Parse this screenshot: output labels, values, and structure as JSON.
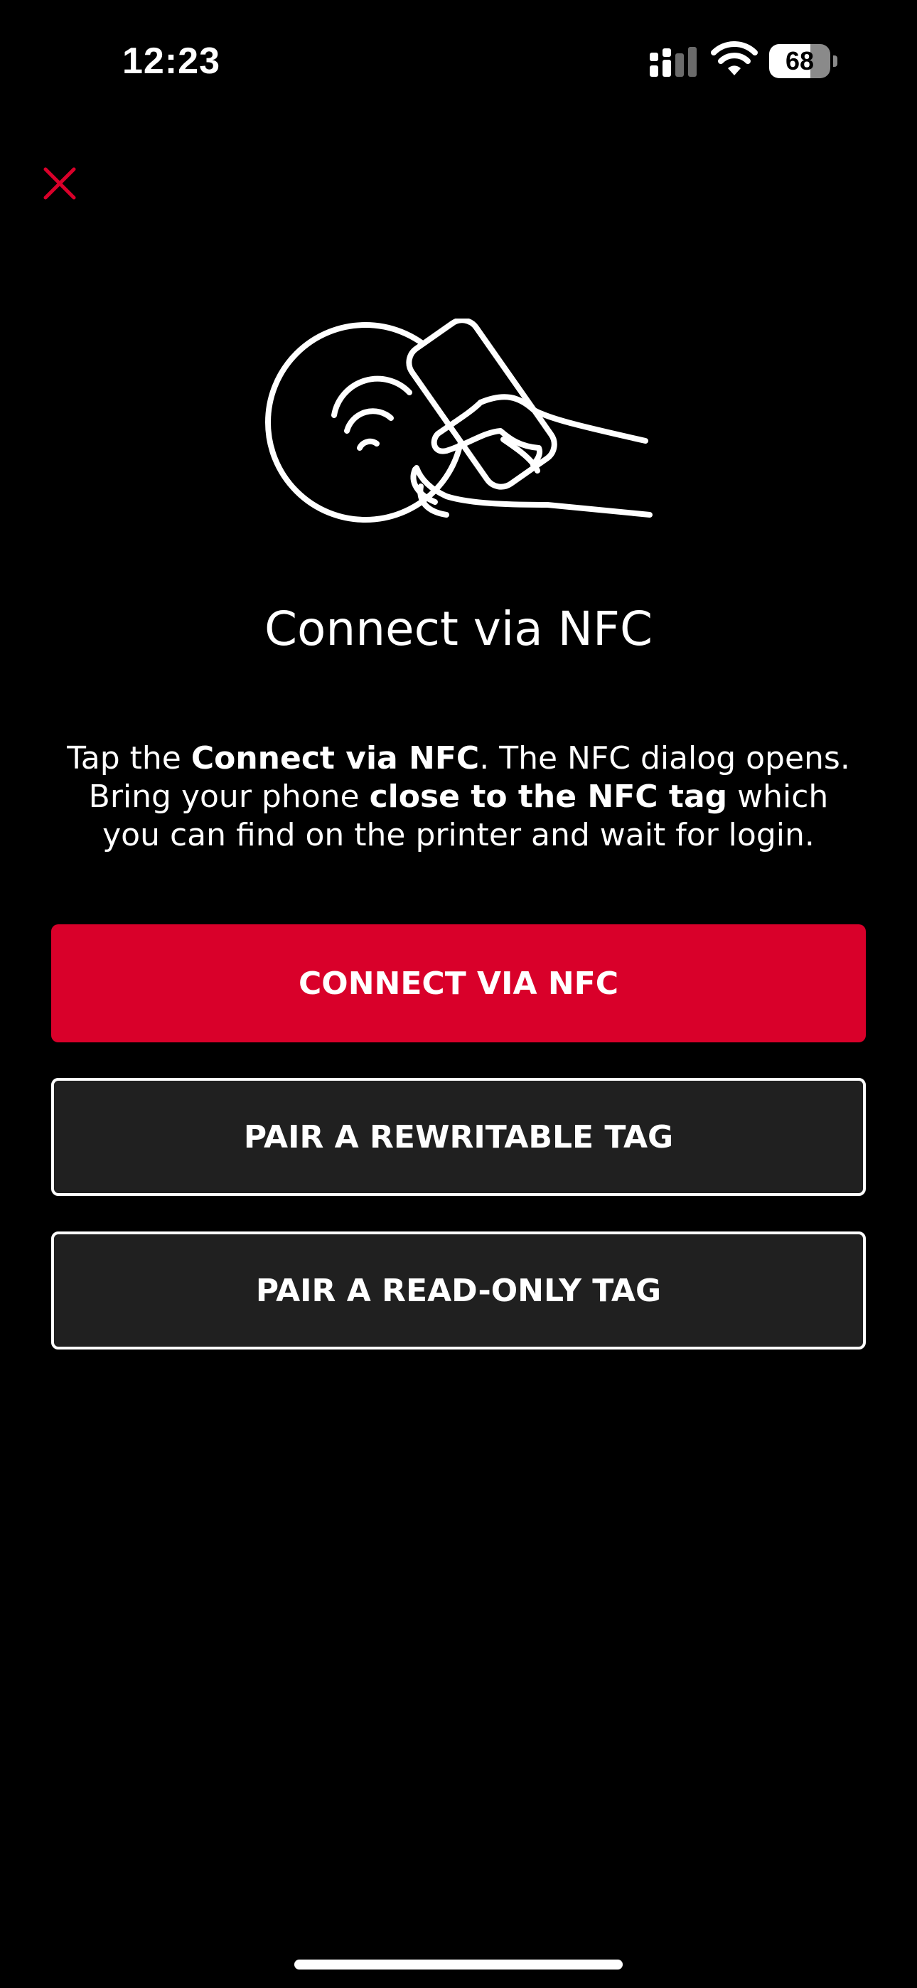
{
  "status_bar": {
    "time": "12:23",
    "battery_level": "68",
    "battery_fraction": 0.68,
    "signal_icon": "cellular-signal-icon",
    "wifi_icon": "wifi-icon"
  },
  "header": {
    "close_icon": "close-icon"
  },
  "illustration": {
    "icon": "nfc-tap-phone-icon"
  },
  "title": "Connect via NFC",
  "description": {
    "part1": "Tap the ",
    "bold1": "Connect via NFC",
    "part2": ". The NFC dialog opens. Bring your phone ",
    "bold2": "close to the NFC tag",
    "part3": " which you can find on the printer and wait for login."
  },
  "buttons": {
    "connect_label": "CONNECT VIA NFC",
    "pair_rewritable_label": "PAIR A REWRITABLE TAG",
    "pair_readonly_label": "PAIR A READ-ONLY TAG"
  },
  "colors": {
    "accent": "#d9002a",
    "background": "#000000",
    "secondary_button_bg": "#202020"
  }
}
